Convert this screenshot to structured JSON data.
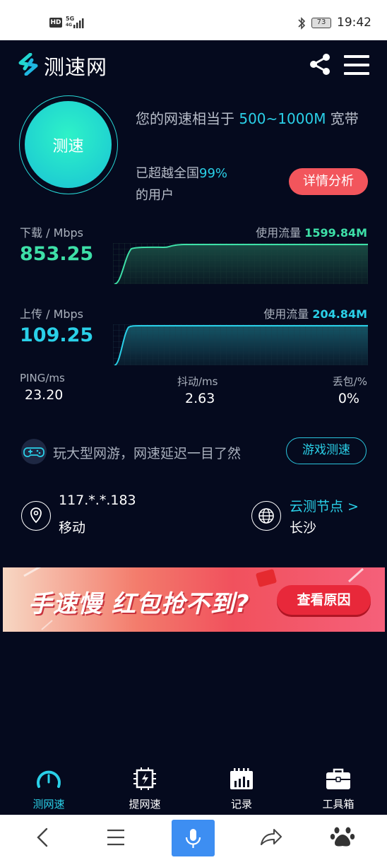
{
  "status_bar": {
    "hd": "HD",
    "network": "5G",
    "network_sub": "4G",
    "battery": "73",
    "time": "19:42"
  },
  "header": {
    "app_name": "测速网",
    "icons": {
      "logo": "logo-icon",
      "share": "share-icon",
      "menu": "menu-icon"
    }
  },
  "test": {
    "button_label": "测速",
    "summary_prefix": "您的网速相当于 ",
    "summary_speed": "500~1000M",
    "summary_suffix": " 宽带",
    "rank_prefix": "已超越全国",
    "rank_percent": "99%",
    "rank_suffix": "的用户",
    "detail_button": "详情分析"
  },
  "download": {
    "label": "下载 / Mbps",
    "value": "853.25",
    "traffic_label": "使用流量",
    "traffic_value": "1599.84M",
    "color": "#3ee0a8"
  },
  "upload": {
    "label": "上传 / Mbps",
    "value": "109.25",
    "traffic_label": "使用流量",
    "traffic_value": "204.84M",
    "color": "#2ad0e8"
  },
  "stats": {
    "ping_label": "PING/ms",
    "ping_value": "23.20",
    "jitter_label": "抖动/ms",
    "jitter_value": "2.63",
    "loss_label": "丢包/%",
    "loss_value": "0%"
  },
  "game": {
    "text": "玩大型网游，网速延迟一目了然",
    "button": "游戏测速"
  },
  "location": {
    "ip": "117.*.*.183",
    "isp": "移动",
    "node_link": "云测节点 >",
    "node_city": "长沙"
  },
  "banner": {
    "text": "手速慢 红包抢不到?",
    "button": "查看原因"
  },
  "tabs": [
    {
      "label": "测网速",
      "icon": "speedometer-icon"
    },
    {
      "label": "提网速",
      "icon": "chip-icon"
    },
    {
      "label": "记录",
      "icon": "calendar-chart-icon"
    },
    {
      "label": "工具箱",
      "icon": "toolbox-icon"
    }
  ],
  "colors": {
    "background": "#050a1e",
    "accent": "#2ad0e8",
    "download_green": "#3ee0a8",
    "detail_red": "#f2555c"
  }
}
